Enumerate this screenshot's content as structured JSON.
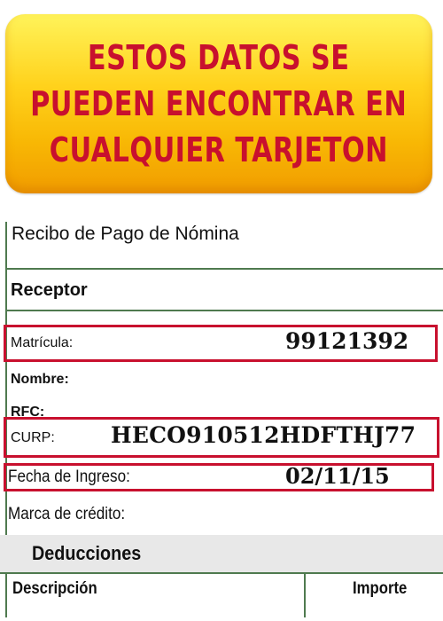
{
  "banner": {
    "lines": [
      "ESTOS DATOS SE",
      "PUEDEN ENCONTRAR EN",
      "CUALQUIER TARJETON"
    ]
  },
  "receipt": {
    "title": "Recibo de Pago de Nómina",
    "receptor_header": "Receptor",
    "matricula_label": "Matrícula:",
    "matricula_value": "99121392",
    "nombre_label": "Nombre:",
    "rfc_label": "RFC:",
    "curp_label": "CURP:",
    "curp_value": "HECO910512HDFTHJ77",
    "fecha_label": "Fecha de Ingreso:",
    "fecha_value": "02/11/15",
    "marca_label": "Marca de crédito:",
    "deducciones_header": "Deducciones",
    "columns": [
      "Descripción",
      "Importe"
    ]
  },
  "colors": {
    "highlight_red": "#c8102e",
    "banner_text": "#c8102e",
    "table_border": "#4f7a4f"
  }
}
